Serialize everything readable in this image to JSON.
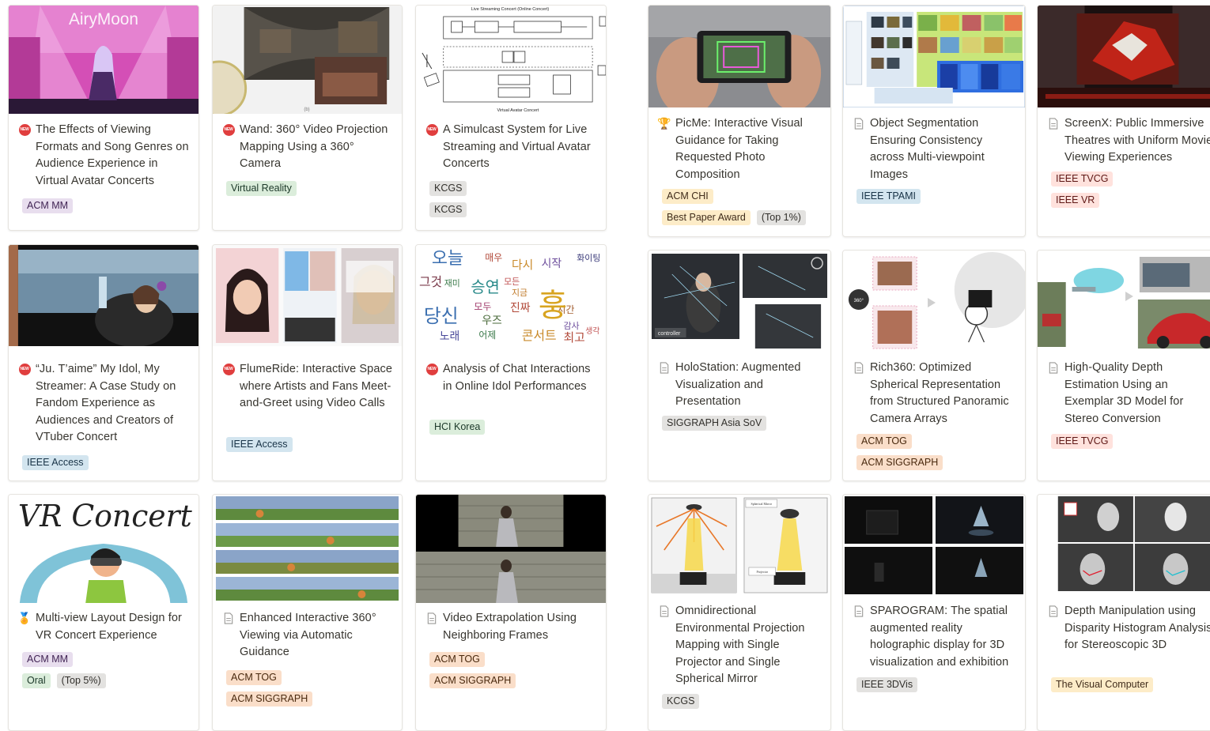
{
  "colors": {
    "new_badge": "#e03e3e",
    "tag_purple": "#e8deee",
    "tag_green": "#dbeddb",
    "tag_gray": "#e3e2e0",
    "tag_blue": "#d3e5ef",
    "tag_orange": "#fadec9",
    "tag_yellow": "#fdecc8",
    "tag_red": "#ffe2dd"
  },
  "new_badge_text": "NEW",
  "cards": [
    {
      "icon": "new-badge-icon",
      "title": "The Effects of Viewing Formats and Song Genres on Audience Experience in Virtual Avatar Concerts",
      "thumb_caption": "AiryMoon",
      "tags": [
        [
          "ACM MM"
        ]
      ]
    },
    {
      "icon": "new-badge-icon",
      "title": "Wand: 360° Video Projection Mapping Using a 360° Camera",
      "thumb_caption": "(b)",
      "tags": [
        [
          "Virtual Reality"
        ]
      ]
    },
    {
      "icon": "new-badge-icon",
      "title": "A Simulcast System for Live Streaming and Virtual Avatar Concerts",
      "thumb_caption": "Live Streaming Concert (Online Concert)",
      "thumb_caption2": "Virtual Avatar Concert",
      "tags": [
        [
          "KCGS"
        ],
        [
          "KCGS"
        ]
      ]
    },
    {
      "icon": "trophy-icon",
      "title": "PicMe: Interactive Visual Guidance for Taking Requested Photo Composition",
      "tags": [
        [
          "ACM CHI"
        ],
        [
          "Best Paper Award",
          "(Top 1%)"
        ]
      ]
    },
    {
      "icon": "document-icon",
      "title": "Object Segmentation Ensuring Consistency across Multi-viewpoint Images",
      "tags": [
        [
          "IEEE TPAMI"
        ]
      ]
    },
    {
      "icon": "document-icon",
      "title": "ScreenX: Public Immersive Theatres with Uniform Movie Viewing Experiences",
      "tags": [
        [
          "IEEE TVCG"
        ],
        [
          "IEEE VR"
        ]
      ]
    },
    {
      "icon": "new-badge-icon",
      "title": "“Ju. T’aime” My Idol, My Streamer: A Case Study on Fandom Experience as Audiences and Creators of VTuber Concert",
      "tags": [
        [
          "IEEE Access"
        ]
      ]
    },
    {
      "icon": "new-badge-icon",
      "title": "FlumeRide: Interactive Space where Artists and Fans Meet-and-Greet using Video Calls",
      "tags": [
        [
          "IEEE Access"
        ]
      ]
    },
    {
      "icon": "new-badge-icon",
      "title": "Analysis of Chat Interactions in Online Idol Performances",
      "thumb_words": [
        "오늘",
        "매우",
        "다시",
        "시작",
        "화이팅",
        "그것",
        "재미",
        "승연",
        "모든",
        "지금",
        "당신",
        "모두",
        "진짜",
        "우즈",
        "노래",
        "어제",
        "콘서트",
        "최고",
        "시간",
        "감사",
        "생각"
      ],
      "tags": [
        [
          "HCI Korea"
        ]
      ]
    },
    {
      "icon": "document-icon",
      "title": "HoloStation: Augmented Visualization and Presentation",
      "thumb_caption": "controller",
      "tags": [
        [
          "SIGGRAPH Asia SoV"
        ]
      ]
    },
    {
      "icon": "document-icon",
      "title": "Rich360: Optimized Spherical Representation from Structured Panoramic Camera Arrays",
      "thumb_caption": "360°",
      "tags": [
        [
          "ACM TOG"
        ],
        [
          "ACM SIGGRAPH"
        ]
      ]
    },
    {
      "icon": "document-icon",
      "title": "High-Quality Depth Estimation Using an Exemplar 3D Model for Stereo Conversion",
      "tags": [
        [
          "IEEE TVCG"
        ]
      ]
    },
    {
      "icon": "medal-icon",
      "title": "Multi-view Layout Design for VR Concert Experience",
      "thumb_caption": "VR Concert",
      "tags": [
        [
          "ACM MM"
        ],
        [
          "Oral",
          "(Top 5%)"
        ]
      ]
    },
    {
      "icon": "document-icon",
      "title": "Enhanced Interactive 360° Viewing via Automatic Guidance",
      "tags": [
        [
          "ACM TOG"
        ],
        [
          "ACM SIGGRAPH"
        ]
      ]
    },
    {
      "icon": "document-icon",
      "title": "Video Extrapolation Using Neighboring Frames",
      "tags": [
        [
          "ACM TOG"
        ],
        [
          "ACM SIGGRAPH"
        ]
      ]
    },
    {
      "icon": "document-icon",
      "title": "Omnidirectional Environmental Projection Mapping with Single Projector and Single Spherical Mirror",
      "thumb_caption": "Spherical Mirror",
      "thumb_caption2": "Projector",
      "tags": [
        [
          "KCGS"
        ]
      ]
    },
    {
      "icon": "document-icon",
      "title": "SPAROGRAM: The spatial augmented reality holographic display for 3D visualization and exhibition",
      "tags": [
        [
          "IEEE 3DVis"
        ]
      ]
    },
    {
      "icon": "document-icon",
      "title": "Depth Manipulation using Disparity Histogram Analysis for Stereoscopic 3D",
      "tags": [
        [
          "The Visual Computer"
        ]
      ]
    }
  ]
}
